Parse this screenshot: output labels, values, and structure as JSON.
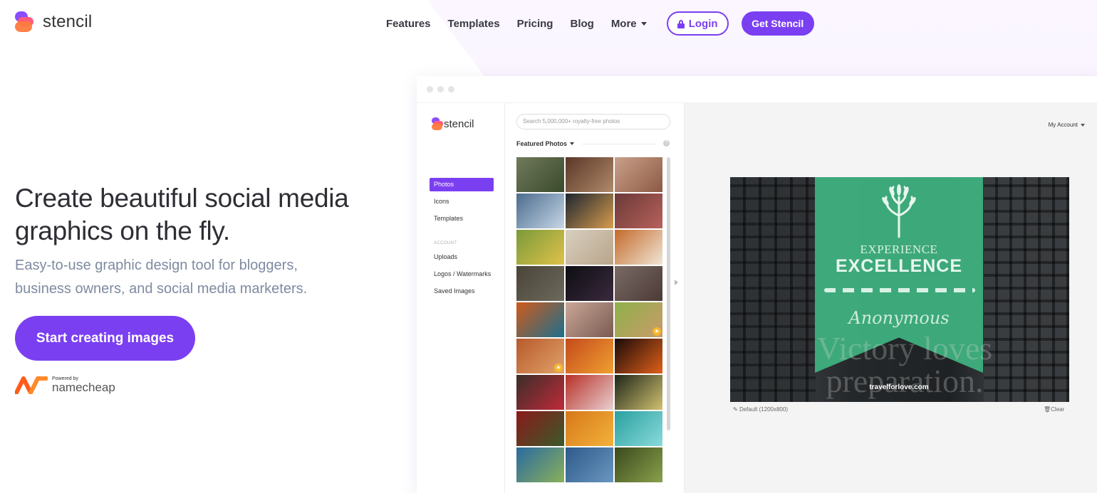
{
  "brand": {
    "name": "stencil"
  },
  "nav": {
    "items": [
      "Features",
      "Templates",
      "Pricing",
      "Blog"
    ],
    "more": "More",
    "login": "Login",
    "get_stencil": "Get Stencil"
  },
  "hero": {
    "title": "Create beautiful social media graphics on the fly.",
    "subtitle": "Easy-to-use graphic design tool for bloggers, business owners, and social media marketers.",
    "cta": "Start creating images",
    "powered_by": "Powered by",
    "partner": "namecheap"
  },
  "app": {
    "logo": "stencil",
    "sidebar": {
      "items": [
        "Photos",
        "Icons",
        "Templates"
      ],
      "account_label": "ACCOUNT",
      "account_items": [
        "Uploads",
        "Logos / Watermarks",
        "Saved Images"
      ]
    },
    "search_placeholder": "Search 5,000,000+ royalty-free photos",
    "featured": "Featured Photos",
    "help": "?",
    "my_account": "My Account",
    "canvas": {
      "line1": "EXPERIENCE",
      "line2": "EXCELLENCE",
      "line3": "Anonymous",
      "line4": "Victory loves preparation.",
      "footer": "travelforlove.com"
    },
    "size_label": "Default (1200x800)",
    "clear_label": "Clear"
  },
  "colors": {
    "accent": "#7b3ff2",
    "banner": "#3fb07e"
  },
  "photo_tiles": [
    [
      "#6f7a5a",
      "#3b4a2c"
    ],
    [
      "#5a3628",
      "#b08a6a"
    ],
    [
      "#c9a08a",
      "#8d5a44"
    ],
    [
      "#4b6c8e",
      "#c7d6e6"
    ],
    [
      "#1e2530",
      "#d79c4d"
    ],
    [
      "#6a3a38",
      "#b8615b"
    ],
    [
      "#7a9a3a",
      "#e0c24a"
    ],
    [
      "#d8cfc0",
      "#b9a58a"
    ],
    [
      "#c46a2b",
      "#f0e6d6"
    ],
    [
      "#4a4438",
      "#6c6a5c"
    ],
    [
      "#0e0e12",
      "#3a2a3e"
    ],
    [
      "#7a6a64",
      "#4b3a36"
    ],
    [
      "#d05a1c",
      "#1b6f8c"
    ],
    [
      "#c9a797",
      "#7a5a52"
    ],
    [
      "#8fb04a",
      "#c99b6a"
    ],
    [
      "#b8592c",
      "#e0a36a"
    ],
    [
      "#c44a1c",
      "#f0a030"
    ],
    [
      "#1a0a08",
      "#e0601a"
    ],
    [
      "#3a2e28",
      "#c02a3a"
    ],
    [
      "#b83028",
      "#e8d0d0"
    ],
    [
      "#1e2618",
      "#d0c070"
    ],
    [
      "#8a1a1a",
      "#3a5a2a"
    ],
    [
      "#d6781a",
      "#f3b23a"
    ],
    [
      "#2aa0a0",
      "#8adada"
    ],
    [
      "#2a6aa0",
      "#8ab05a"
    ],
    [
      "#2e5a8a",
      "#6a96c0"
    ],
    [
      "#3a4a1e",
      "#8aa04a"
    ]
  ]
}
